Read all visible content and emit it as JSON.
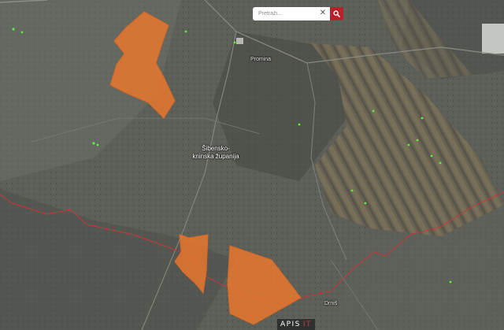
{
  "search": {
    "placeholder": "Pretraži...",
    "clear_icon": "close-icon",
    "button_icon": "search-icon"
  },
  "map": {
    "labels": {
      "settlement_north": "Promina",
      "county": "Šibensko-kninska županija",
      "settlement_south": "Drniš"
    },
    "layers": {
      "parcel_fill_color": "#e8772e",
      "boundary_color": "#c23a3a",
      "poi_color": "#5cf03c"
    }
  },
  "branding": {
    "logo_main": "APIS",
    "logo_accent": "IT"
  }
}
